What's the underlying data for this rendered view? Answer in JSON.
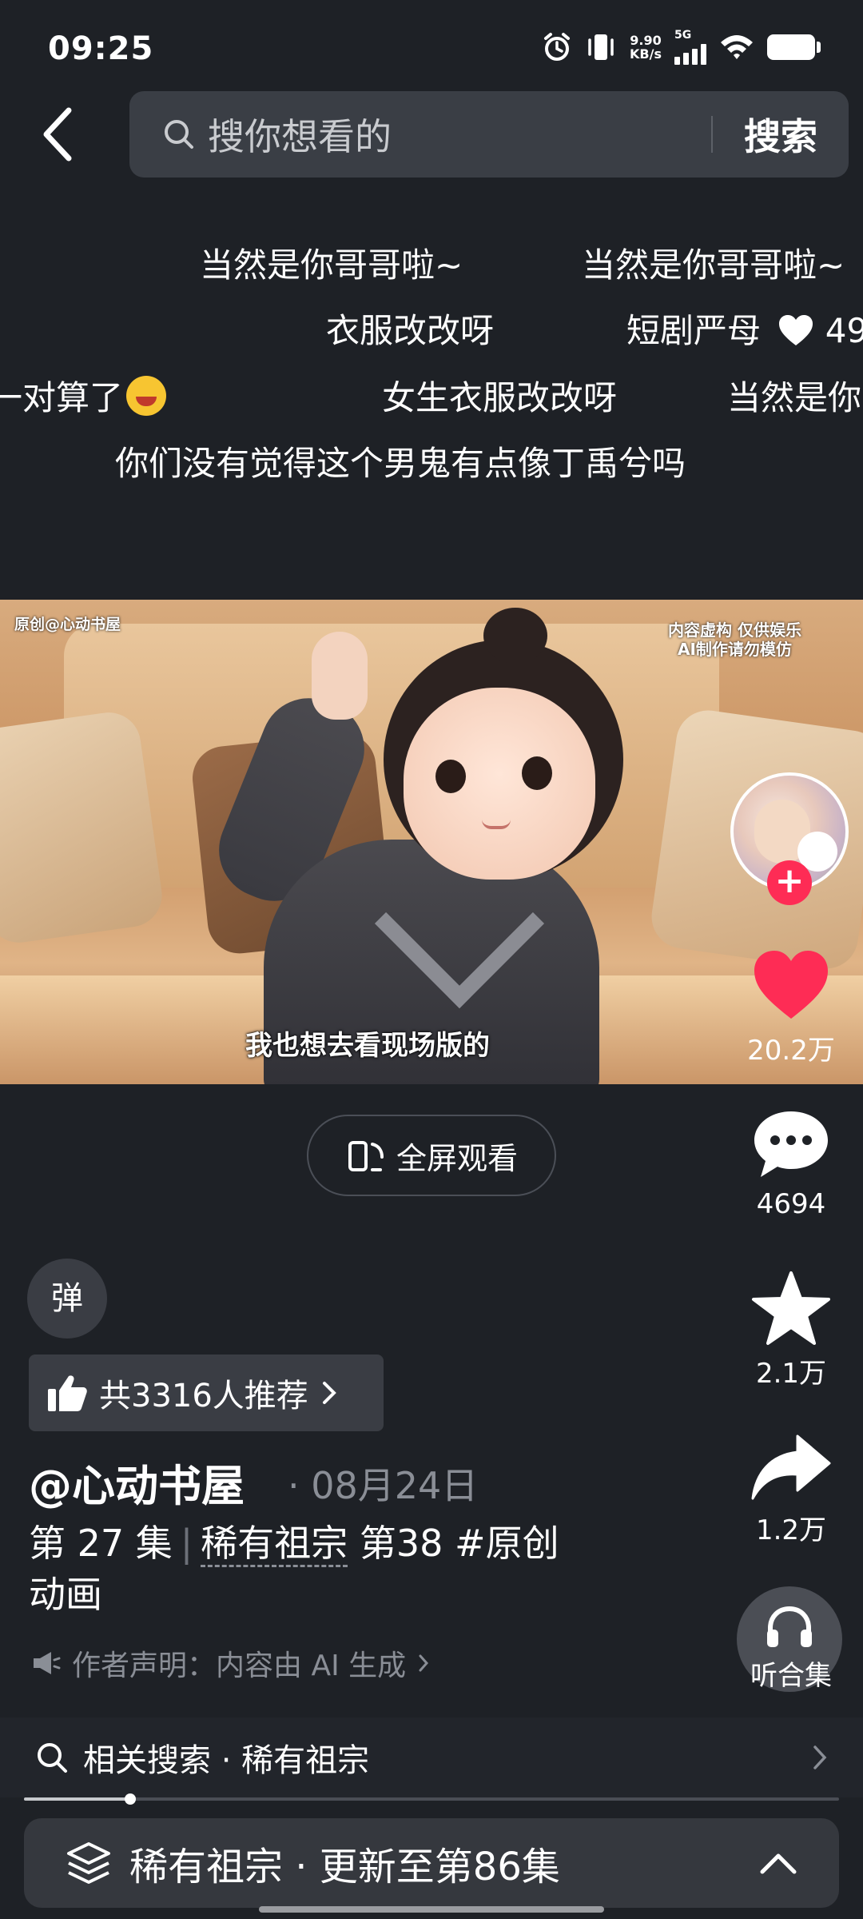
{
  "status_bar": {
    "time": "09:25",
    "net_speed_value": "9.90",
    "net_speed_unit": "KB/s",
    "network": "5G"
  },
  "search": {
    "placeholder": "搜你想看的",
    "submit_label": "搜索"
  },
  "danmaku": [
    "当然是你哥哥啦~",
    "当然是你哥哥啦~",
    "衣服改改呀",
    "短剧严母",
    "49",
    "一对算了",
    "女生衣服改改呀",
    "当然是你",
    "你们没有觉得这个男鬼有点像丁禹兮吗"
  ],
  "video": {
    "tag_left": "原创@心动书屋",
    "tag_right_line1": "内容虚构 仅供娱乐",
    "tag_right_line2": "AI制作请勿模仿",
    "subtitle": "我也想去看现场版的"
  },
  "rail": {
    "likes": "20.2万",
    "comments": "4694",
    "favorites": "2.1万",
    "shares": "1.2万",
    "listen_label": "听合集"
  },
  "fullscreen_label": "全屏观看",
  "danmu_toggle_label": "弹",
  "recommend_label": "共3316人推荐",
  "author": "@心动书屋",
  "date": "· 08月24日",
  "desc": {
    "episode": "第 27 集",
    "series": "稀有祖宗",
    "rest": "第38 #原创",
    "line2": "动画"
  },
  "disclaimer": "作者声明：内容由 AI 生成",
  "related_search": "相关搜索 · 稀有祖宗",
  "progress": 0.13,
  "series_bar_label": "稀有祖宗 · 更新至第86集",
  "colors": {
    "background": "#1e2126",
    "accent_like": "#fe2c55",
    "search_box": "#3a3e45"
  }
}
